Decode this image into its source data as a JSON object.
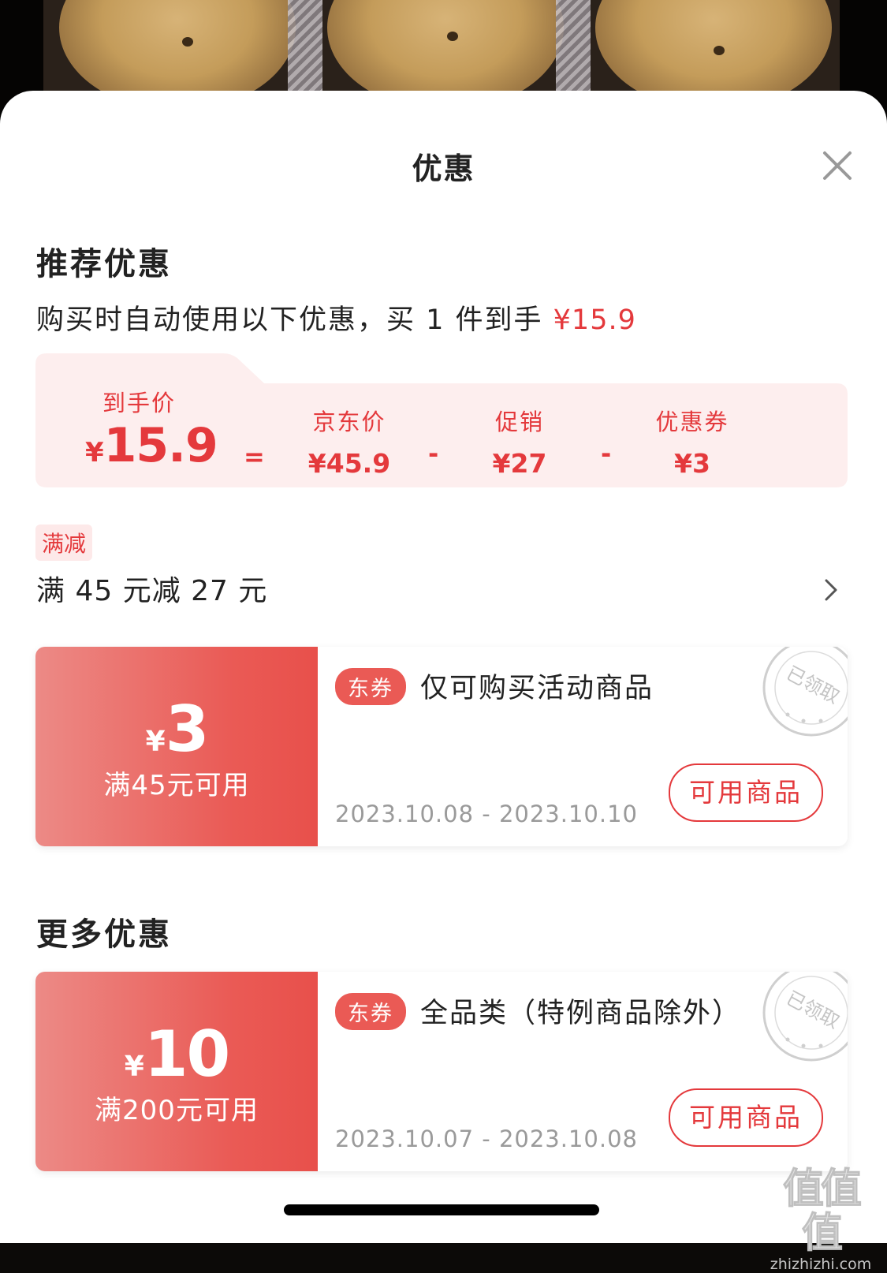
{
  "sheet": {
    "title": "优惠",
    "close_icon": "close-icon"
  },
  "recommended": {
    "heading": "推荐优惠",
    "description_prefix": "购买时自动使用以下优惠，买 1 件到手 ",
    "description_price": "¥15.9",
    "breakdown": {
      "final_label": "到手价",
      "final_currency": "¥",
      "final_value": "15.9",
      "equals": "=",
      "minus": "-",
      "items": [
        {
          "label": "京东价",
          "value": "¥45.9"
        },
        {
          "label": "促销",
          "value": "¥27"
        },
        {
          "label": "优惠券",
          "value": "¥3"
        }
      ]
    },
    "promo_tag": "满减",
    "promo_text": "满 45 元减 27 元",
    "coupon": {
      "currency": "¥",
      "amount": "3",
      "condition": "满45元可用",
      "tag": "东券",
      "description": "仅可购买活动商品",
      "date_range": "2023.10.08 - 2023.10.10",
      "button": "可用商品",
      "stamp": "已领取"
    }
  },
  "more": {
    "heading": "更多优惠",
    "coupon": {
      "currency": "¥",
      "amount": "10",
      "condition": "满200元可用",
      "tag": "东券",
      "description": "全品类（特例商品除外）",
      "date_range": "2023.10.07 - 2023.10.08",
      "button": "可用商品",
      "stamp": "已领取"
    }
  },
  "watermark": {
    "logo_text": "值值值",
    "site": "zhizhizhi.com"
  },
  "colors": {
    "accent": "#e4393c",
    "coupon_gradient_start": "#ec8a86",
    "coupon_gradient_end": "#e8504b",
    "breakdown_bg": "#fdeeee"
  }
}
